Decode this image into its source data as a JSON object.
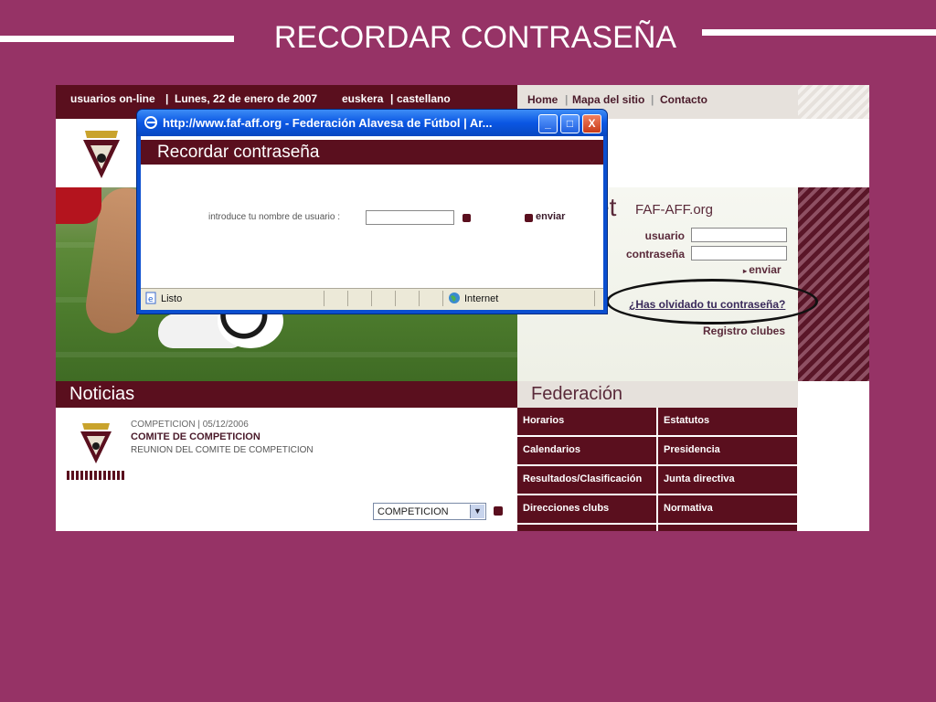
{
  "slide": {
    "title": "RECORDAR CONTRASEÑA",
    "background_color": "#963366"
  },
  "topbar": {
    "online": "usuarios on-line",
    "date": "Lunes, 22 de enero de 2007",
    "lang_eu": "euskera",
    "lang_es": "castellano",
    "sep": "|"
  },
  "nav": {
    "home": "Home",
    "sitemap": "Mapa del sitio",
    "contact": "Contacto",
    "sep": "|"
  },
  "login": {
    "title_fragment": "et",
    "site": "FAF-AFF.org",
    "user_label": "usuario",
    "password_label": "contraseña",
    "submit_label": "enviar",
    "forgot_link": "¿Has olvidado tu contraseña?",
    "register_link": "Registro clubes"
  },
  "news": {
    "section_title": "Noticias",
    "meta": "COMPETICION | 05/12/2006",
    "headline": "COMITE DE COMPETICION",
    "summary": "REUNION DEL COMITE DE COMPETICION",
    "category_select": "COMPETICION"
  },
  "federation": {
    "section_title": "Federación",
    "left_items": [
      "Horarios",
      "Calendarios",
      "Resultados/Clasificación",
      "Direcciones clubs"
    ],
    "right_items": [
      "Estatutos",
      "Presidencia",
      "Junta directiva",
      "Normativa"
    ]
  },
  "popup": {
    "window_title": "http://www.faf-aff.org - Federación Alavesa de Fútbol | Ar...",
    "header": "Recordar contraseña",
    "field_label": "introduce tu nombre de usuario :",
    "submit_label": "enviar",
    "status_left": "Listo",
    "status_zone": "Internet",
    "btn_min": "_",
    "btn_max": "□",
    "btn_close": "X"
  },
  "colors": {
    "brand_maroon": "#5a0f1e",
    "xp_blue": "#0a56e3"
  }
}
